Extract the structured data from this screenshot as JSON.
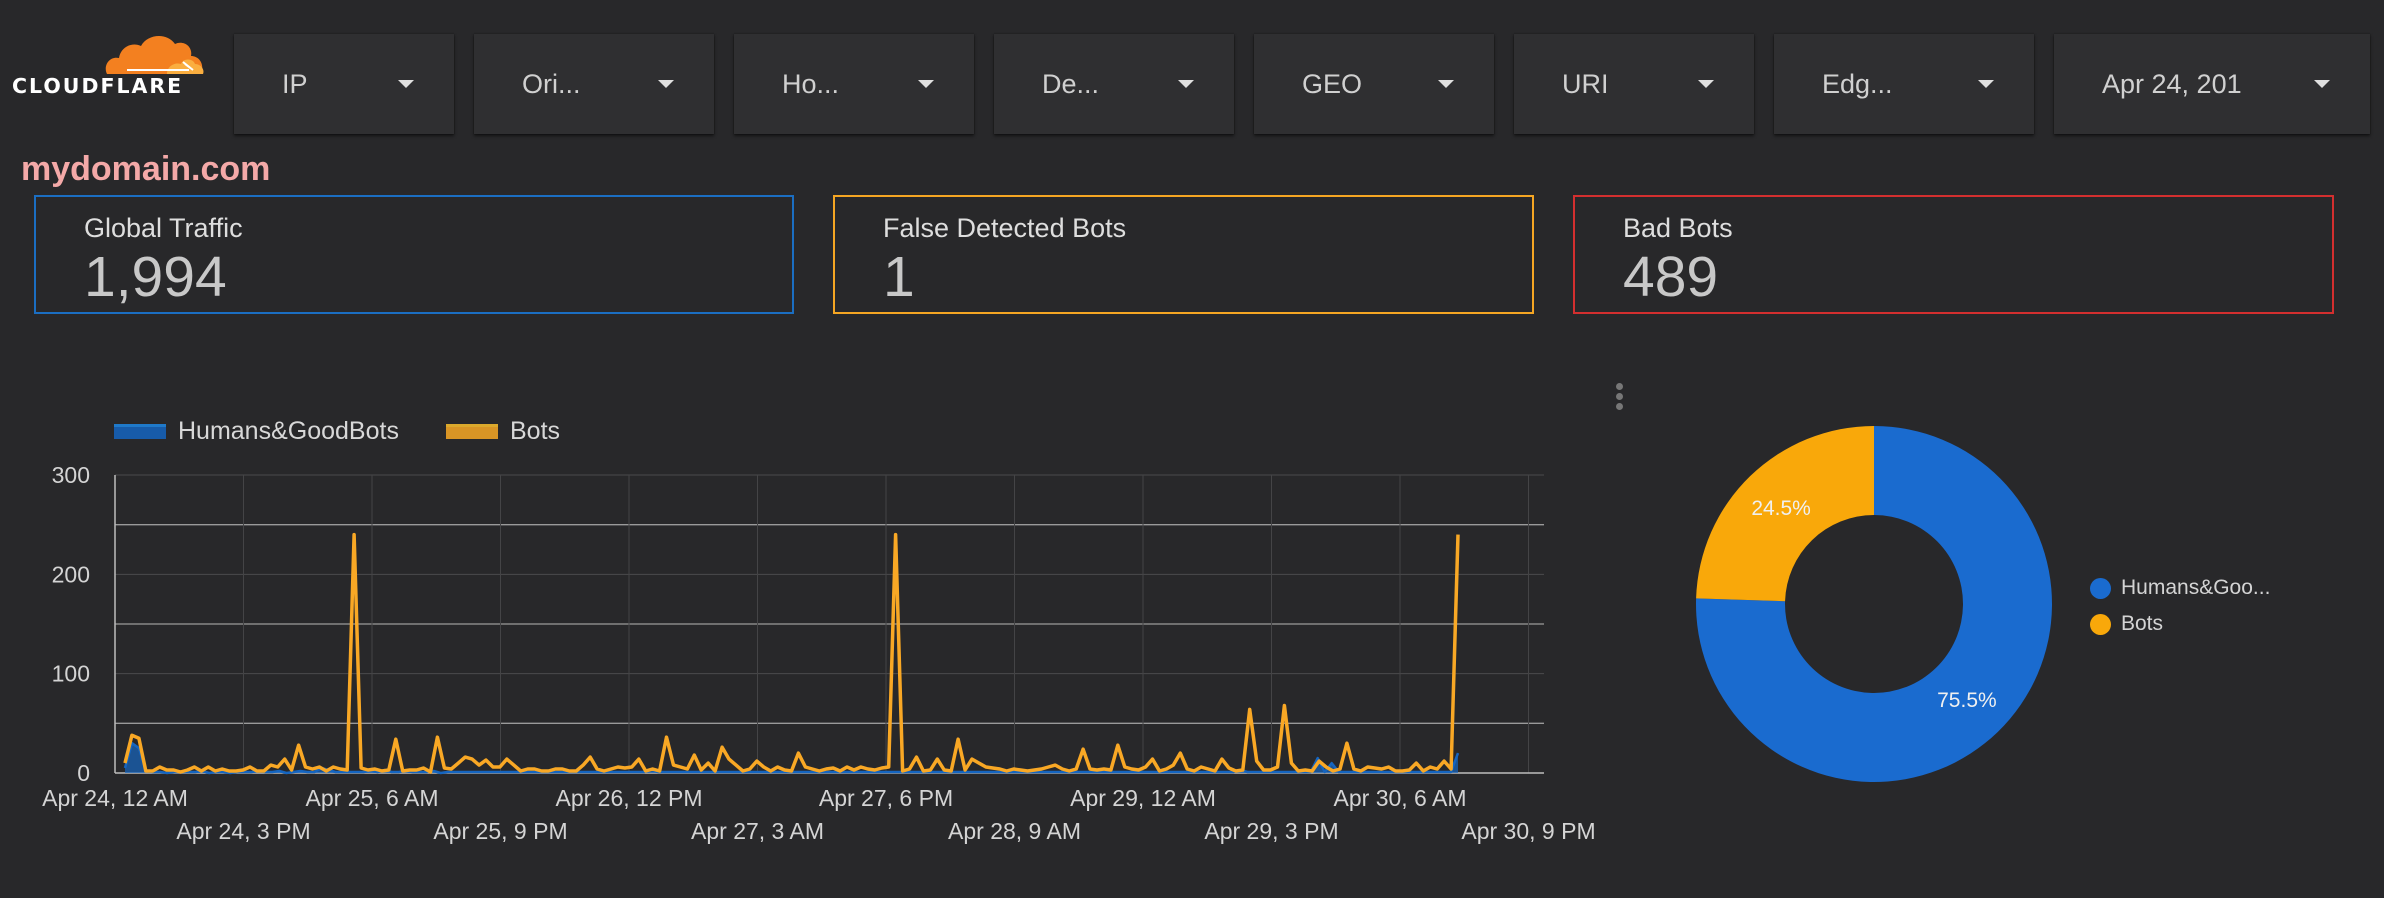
{
  "brand": {
    "name": "CLOUDFLARE",
    "colors": {
      "orange": "#f38020",
      "light_orange": "#faae40"
    }
  },
  "filters": [
    {
      "label": "IP"
    },
    {
      "label": "Ori..."
    },
    {
      "label": "Ho..."
    },
    {
      "label": "De..."
    },
    {
      "label": "GEO"
    },
    {
      "label": "URI"
    },
    {
      "label": "Edg..."
    },
    {
      "label": "Apr 24, 201"
    }
  ],
  "site": {
    "name": "mydomain.com"
  },
  "kpis": [
    {
      "title": "Global Traffic",
      "value": "1,994",
      "color": "#1b6ec2"
    },
    {
      "title": "False Detected Bots",
      "value": "1",
      "color": "#f5a623"
    },
    {
      "title": "Bad Bots",
      "value": "489",
      "color": "#d32f2f"
    }
  ],
  "chart_data": [
    {
      "type": "line",
      "y_ticks": [
        "300",
        "200",
        "100",
        "0"
      ],
      "ylim": [
        0,
        300
      ],
      "x_ticks_top": [
        "Apr 24, 12 AM",
        "Apr 25, 6 AM",
        "Apr 26, 12 PM",
        "Apr 27, 6 PM",
        "Apr 29, 12 AM",
        "Apr 30, 6 AM"
      ],
      "x_ticks_bottom": [
        "Apr 24, 3 PM",
        "Apr 25, 9 PM",
        "Apr 27, 3 AM",
        "Apr 28, 9 AM",
        "Apr 29, 3 PM",
        "Apr 30, 9 PM"
      ],
      "grid": true,
      "legend_position": "top-left",
      "series": [
        {
          "name": "Humans&GoodBots",
          "color": "#1565c0",
          "values": [
            5,
            30,
            25,
            2,
            1,
            1,
            0,
            1,
            1,
            1,
            1,
            2,
            0,
            1,
            1,
            0,
            1,
            1,
            1,
            2,
            1,
            1,
            2,
            0,
            1,
            2,
            1,
            1,
            5,
            3,
            1,
            1,
            1,
            1,
            1,
            2,
            1,
            3,
            1,
            1,
            2,
            1,
            1,
            1,
            2,
            0,
            1,
            1,
            1,
            1,
            1,
            1,
            1,
            1,
            1,
            1,
            1,
            1,
            1,
            1,
            1,
            1,
            1,
            1,
            1,
            1,
            1,
            1,
            1,
            1,
            1,
            1,
            1,
            1,
            1,
            3,
            1,
            1,
            1,
            1,
            1,
            1,
            1,
            1,
            1,
            1,
            1,
            1,
            1,
            1,
            1,
            1,
            1,
            1,
            1,
            1,
            1,
            1,
            1,
            1,
            1,
            1,
            1,
            1,
            1,
            1,
            1,
            1,
            1,
            1,
            1,
            1,
            1,
            1,
            1,
            1,
            1,
            1,
            1,
            1,
            1,
            1,
            1,
            1,
            1,
            1,
            1,
            1,
            1,
            1,
            1,
            1,
            1,
            1,
            1,
            1,
            1,
            1,
            1,
            1,
            1,
            1,
            1,
            1,
            1,
            1,
            1,
            1,
            1,
            1,
            1,
            1,
            1,
            1,
            1,
            1,
            1,
            1,
            1,
            3,
            1,
            1,
            1,
            1,
            1,
            1,
            1,
            1,
            1,
            1,
            15,
            1,
            10,
            1,
            1,
            1,
            1,
            1,
            1,
            1,
            1,
            1,
            1,
            1,
            1,
            1,
            1,
            1,
            1,
            1,
            20
          ]
        },
        {
          "name": "Bots",
          "color": "#f9a825",
          "values": [
            10,
            38,
            35,
            2,
            2,
            6,
            3,
            3,
            1,
            3,
            6,
            2,
            6,
            2,
            4,
            2,
            2,
            3,
            6,
            2,
            2,
            8,
            6,
            14,
            3,
            28,
            6,
            4,
            6,
            2,
            6,
            4,
            3,
            240,
            5,
            3,
            4,
            2,
            3,
            34,
            2,
            3,
            3,
            5,
            1,
            36,
            5,
            4,
            10,
            16,
            14,
            8,
            13,
            6,
            6,
            14,
            8,
            2,
            4,
            4,
            2,
            2,
            4,
            4,
            2,
            2,
            8,
            16,
            4,
            2,
            4,
            6,
            5,
            6,
            14,
            2,
            4,
            2,
            36,
            8,
            6,
            4,
            18,
            3,
            10,
            2,
            26,
            14,
            8,
            2,
            4,
            12,
            6,
            2,
            6,
            3,
            2,
            20,
            6,
            4,
            2,
            4,
            5,
            2,
            6,
            3,
            6,
            4,
            3,
            5,
            6,
            240,
            2,
            4,
            16,
            2,
            3,
            14,
            3,
            2,
            34,
            3,
            14,
            10,
            6,
            5,
            4,
            2,
            4,
            3,
            2,
            3,
            4,
            6,
            8,
            4,
            2,
            4,
            24,
            4,
            3,
            4,
            3,
            28,
            6,
            4,
            3,
            6,
            14,
            2,
            4,
            8,
            20,
            4,
            2,
            6,
            4,
            2,
            14,
            5,
            2,
            3,
            64,
            12,
            3,
            3,
            6,
            68,
            10,
            2,
            3,
            2,
            12,
            6,
            2,
            4,
            30,
            4,
            2,
            6,
            5,
            4,
            6,
            2,
            2,
            3,
            10,
            2,
            6,
            4,
            12,
            4,
            240
          ]
        }
      ]
    },
    {
      "type": "pie",
      "donut": true,
      "slices": [
        {
          "name": "Humans&Goo...",
          "value": 75.5,
          "label": "75.5%",
          "color": "#1a6bcf"
        },
        {
          "name": "Bots",
          "value": 24.5,
          "label": "24.5%",
          "color": "#f9a80a"
        }
      ],
      "legend_position": "right"
    }
  ]
}
